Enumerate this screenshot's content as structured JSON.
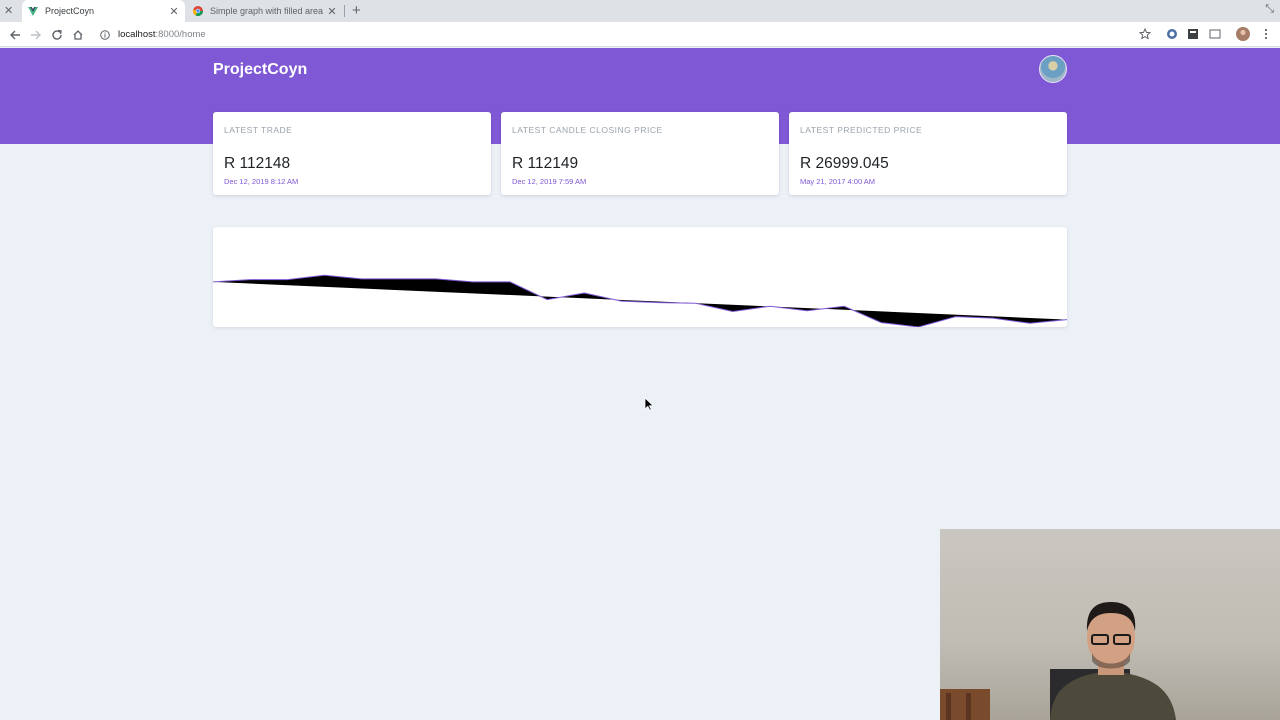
{
  "browser": {
    "tabs": [
      {
        "title": "ProjectCoyn",
        "active": true
      },
      {
        "title": "Simple graph with filled area in",
        "active": false
      }
    ],
    "url_host": "localhost",
    "url_path": ":8000/home"
  },
  "app": {
    "brand": "ProjectCoyn",
    "accent_color": "#7f58d5",
    "cards": [
      {
        "label": "Latest Trade",
        "value": "R 112148",
        "date": "Dec 12, 2019 8:12 AM"
      },
      {
        "label": "Latest Candle Closing Price",
        "value": "R 112149",
        "date": "Dec 12, 2019 7:59 AM"
      },
      {
        "label": "Latest Predicted Price",
        "value": "R 26999.045",
        "date": "May 21, 2017 4:00 AM"
      }
    ]
  },
  "chart_data": {
    "type": "area",
    "title": "",
    "xlabel": "",
    "ylabel": "",
    "grid": false,
    "legend": "none",
    "ylim": [
      0,
      100
    ],
    "line_color": "#7f58d5",
    "fill_color": "#000000",
    "values": [
      61,
      64,
      64,
      70,
      65,
      65,
      65,
      61,
      61,
      37,
      46,
      35,
      33,
      32,
      21,
      28,
      22,
      28,
      6,
      0,
      14,
      12,
      5,
      10
    ]
  },
  "icons": {
    "favicon_active": "vue-logo-icon",
    "favicon_other": "chrome-icon",
    "info": "info-icon"
  }
}
